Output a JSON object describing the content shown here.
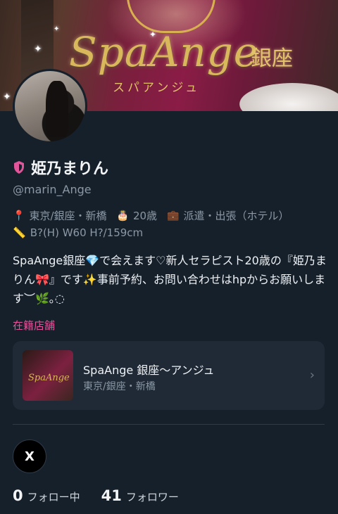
{
  "banner": {
    "logo_text": "SpaAnge",
    "logo_jp": "銀座",
    "logo_kana": "スパアンジュ"
  },
  "profile": {
    "name": "姫乃まりん",
    "handle": "@marin_Ange",
    "location_icon": "pin-icon",
    "location": "東京/銀座・新橋",
    "age_icon": "cake-icon",
    "age": "20歳",
    "work_icon": "briefcase-icon",
    "work": "派遣・出張（ホテル）",
    "measure_icon": "ruler-icon",
    "measurements": "B?(H) W60 H?/159cm",
    "bio": "SpaAnge銀座💎で会えます♡新人セラピスト20歳の『姫乃まりん🎀』です✨事前予約、お問い合わせはhpからお願いします︶🌿｡◌"
  },
  "shop_section": {
    "label": "在籍店舗",
    "shop_name": "SpaAnge 銀座〜アンジュ",
    "shop_location": "東京/銀座・新橋",
    "thumb_text": "SpaAnge"
  },
  "social": {
    "x_label": "X"
  },
  "stats": {
    "following_count": "0",
    "following_label": "フォロー中",
    "followers_count": "41",
    "followers_label": "フォロワー"
  },
  "colors": {
    "background": "#16202b",
    "accent_pink": "#e2559a",
    "muted_text": "#8b98a5"
  }
}
